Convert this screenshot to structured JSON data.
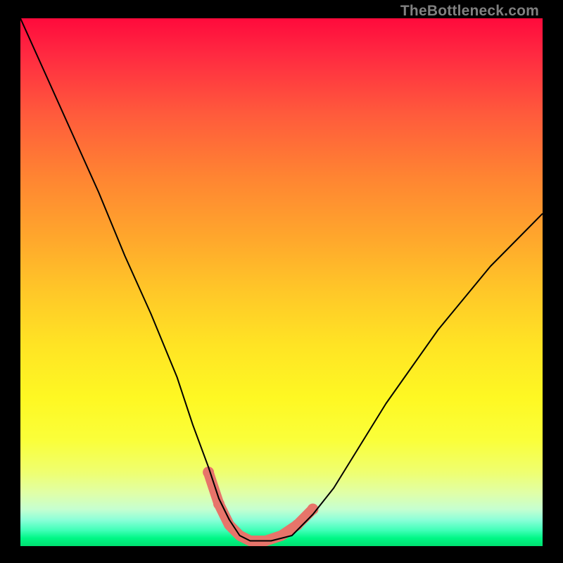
{
  "watermark": "TheBottleneck.com",
  "chart_data": {
    "type": "line",
    "title": "",
    "xlabel": "",
    "ylabel": "",
    "xlim": [
      0,
      100
    ],
    "ylim": [
      0,
      100
    ],
    "grid": false,
    "series": [
      {
        "name": "bottleneck-curve",
        "x": [
          0,
          5,
          10,
          15,
          20,
          25,
          30,
          33,
          36,
          38,
          40,
          42,
          44,
          48,
          52,
          56,
          60,
          65,
          70,
          75,
          80,
          85,
          90,
          95,
          100
        ],
        "y": [
          100,
          89,
          78,
          67,
          55,
          44,
          32,
          23,
          15,
          9,
          5,
          2,
          1,
          1,
          2,
          6,
          11,
          19,
          27,
          34,
          41,
          47,
          53,
          58,
          63
        ]
      }
    ],
    "highlight": {
      "name": "optimal-flat-region",
      "x": [
        36,
        38,
        40,
        42,
        44,
        47,
        50,
        53,
        56
      ],
      "y": [
        14,
        8,
        4,
        2,
        1,
        1,
        2,
        4,
        7
      ],
      "color": "#e7746a"
    },
    "gradient_meaning": "top (red) = high bottleneck, bottom (green) = low/no bottleneck"
  },
  "colors": {
    "curve": "#000000",
    "highlight": "#e7746a",
    "frame": "#000000",
    "watermark": "#808080"
  }
}
